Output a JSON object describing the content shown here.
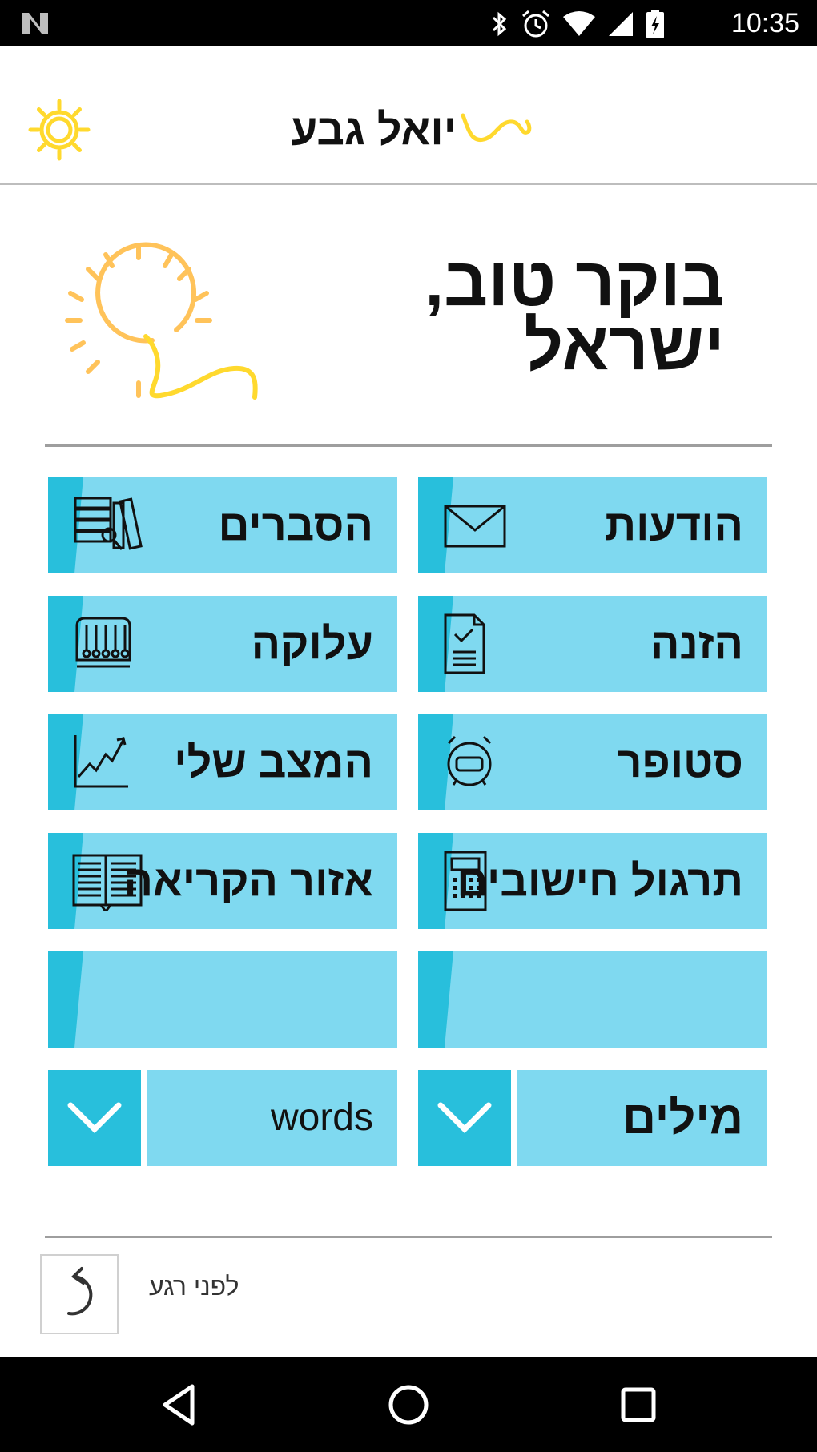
{
  "status_bar": {
    "time": "10:35",
    "icons": [
      "n-logo-icon",
      "bluetooth-icon",
      "alarm-icon",
      "wifi-icon",
      "signal-icon",
      "battery-charging-icon"
    ]
  },
  "app_bar": {
    "title": "יואל גבע",
    "icons": [
      "settings-gear-icon",
      "brand-wave-icon"
    ]
  },
  "greeting": {
    "line1": "בוקר טוב,",
    "line2": "ישראל",
    "icon": "sun-icon"
  },
  "tiles": [
    {
      "label": "הודעות",
      "icon": "envelope-icon"
    },
    {
      "label": "הסברים",
      "icon": "books-search-icon"
    },
    {
      "label": "הזנה",
      "icon": "document-check-icon"
    },
    {
      "label": "עלוקה",
      "icon": "abacus-icon"
    },
    {
      "label": "סטופר",
      "icon": "alarm-clock-icon"
    },
    {
      "label": "המצב שלי",
      "icon": "line-chart-icon"
    },
    {
      "label": "תרגול חישובים",
      "icon": "calculator-icon"
    },
    {
      "label": "אזור הקריאה",
      "icon": "open-book-icon"
    },
    {
      "label": "",
      "icon": ""
    },
    {
      "label": "",
      "icon": ""
    }
  ],
  "dropdowns": [
    {
      "value": "מילים",
      "icon": "chevron-down-icon"
    },
    {
      "value": "words",
      "icon": "chevron-down-icon"
    }
  ],
  "footer": {
    "undo_text": "לפני רגע",
    "undo_icon": "undo-icon"
  },
  "nav_bar": {
    "icons": [
      "back-triangle-icon",
      "home-circle-icon",
      "recents-square-icon"
    ]
  },
  "colors": {
    "tile": "#7fd9f0",
    "tile_accent": "#28bfdc",
    "sun_orange": "#ffc35a",
    "logo_yellow": "#ffd92e"
  }
}
